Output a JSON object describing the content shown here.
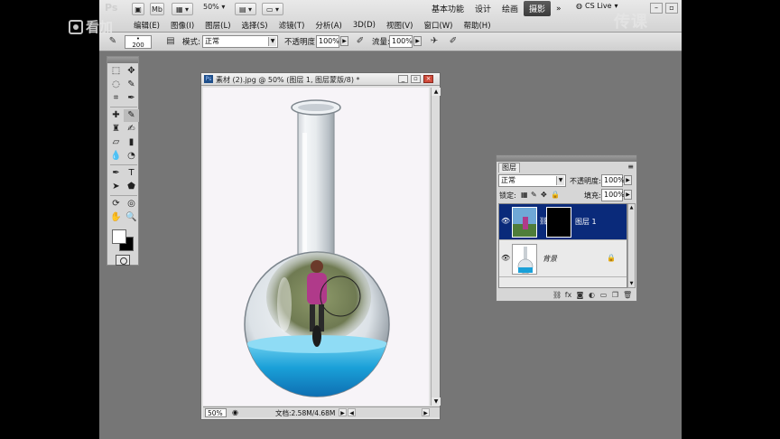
{
  "watermarks": {
    "left": "看加",
    "right": "传课"
  },
  "appbar": {
    "logo": "Ps",
    "zoom": "50%",
    "workspaces": [
      {
        "label": "基本功能"
      },
      {
        "label": "设计"
      },
      {
        "label": "绘画"
      },
      {
        "label": "摄影",
        "active": true
      }
    ],
    "more": "»",
    "cs_live": "CS Live"
  },
  "menu": [
    "编辑(E)",
    "图像(I)",
    "图层(L)",
    "选择(S)",
    "滤镜(T)",
    "分析(A)",
    "3D(D)",
    "视图(V)",
    "窗口(W)",
    "帮助(H)"
  ],
  "options": {
    "brush_size": "200",
    "mode_label": "模式:",
    "mode_value": "正常",
    "opacity_label": "不透明度:",
    "opacity_value": "100%",
    "flow_label": "流量:",
    "flow_value": "100%"
  },
  "document": {
    "title": "素材 (2).jpg @ 50% (图层 1, 图层蒙版/8) *",
    "zoom": "50%",
    "info": "文档:2.58M/4.68M"
  },
  "layers_panel": {
    "tab": "图层",
    "blend_mode": "正常",
    "opacity_label": "不透明度:",
    "opacity_value": "100%",
    "lock_label": "锁定:",
    "fill_label": "填充:",
    "fill_value": "100%",
    "layers": [
      {
        "name": "图层 1",
        "selected": true
      },
      {
        "name": "背景",
        "selected": false
      }
    ]
  }
}
